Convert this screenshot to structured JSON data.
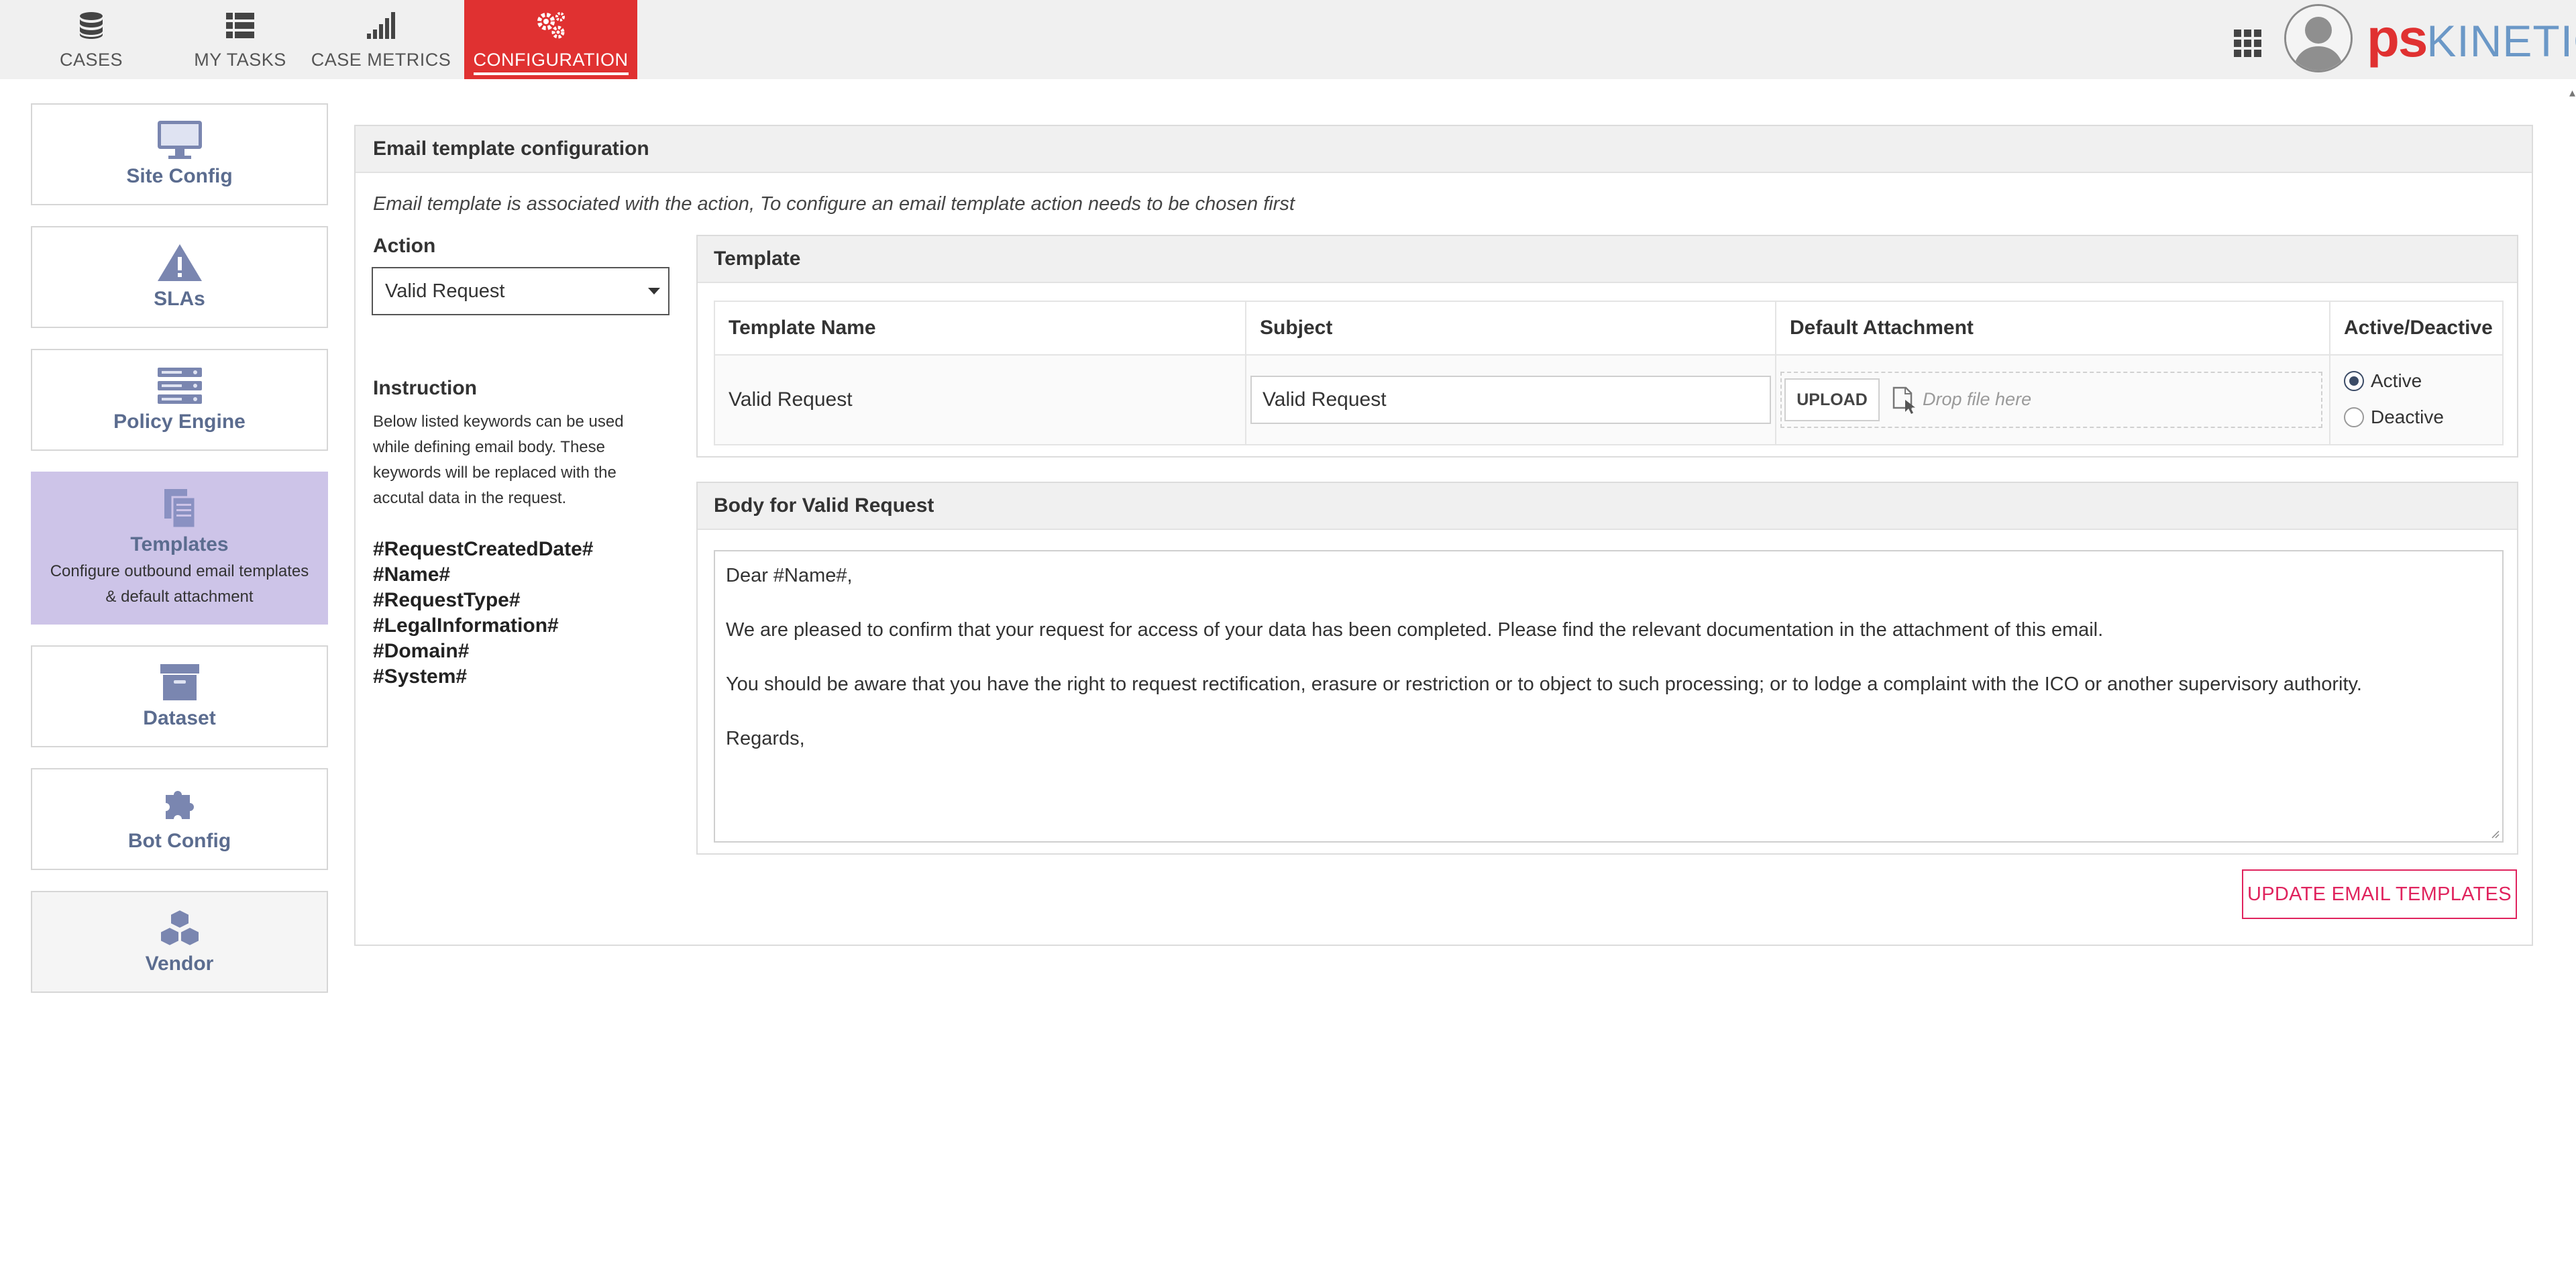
{
  "nav": {
    "items": [
      {
        "label": "CASES",
        "icon": "database-icon"
      },
      {
        "label": "MY TASKS",
        "icon": "list-icon"
      },
      {
        "label": "CASE METRICS",
        "icon": "signal-bars-icon"
      },
      {
        "label": "CONFIGURATION",
        "icon": "gears-icon",
        "active": true
      }
    ],
    "accent": "#e03131"
  },
  "brand": {
    "ps": "ps",
    "kinetic": "KINETIC"
  },
  "sidebar": {
    "items": [
      {
        "title": "Site Config",
        "icon": "monitor-icon"
      },
      {
        "title": "SLAs",
        "icon": "warning-icon"
      },
      {
        "title": "Policy Engine",
        "icon": "server-icon"
      },
      {
        "title": "Templates",
        "icon": "documents-icon",
        "description": "Configure outbound email templates & default attachment",
        "active": true
      },
      {
        "title": "Dataset",
        "icon": "archive-box-icon"
      },
      {
        "title": "Bot Config",
        "icon": "puzzle-icon"
      },
      {
        "title": "Vendor",
        "icon": "cubes-icon"
      }
    ],
    "active_color": "#cdc4e8"
  },
  "main": {
    "title": "Email template configuration",
    "note": "Email template is associated with the action, To configure an email template action needs to be chosen first",
    "action_label": "Action",
    "action_value": "Valid Request",
    "instruction_title": "Instruction",
    "instruction_text": "Below listed keywords can be used while defining email body. These keywords will be replaced with the accutal data in the request.",
    "keywords": [
      "#RequestCreatedDate#",
      "#Name#",
      "#RequestType#",
      "#LegalInformation#",
      "#Domain#",
      "#System#"
    ]
  },
  "template": {
    "title": "Template",
    "columns": [
      "Template Name",
      "Subject",
      "Default Attachment",
      "Active/Deactive"
    ],
    "row": {
      "name": "Valid Request",
      "subject": "Valid Request",
      "upload_label": "UPLOAD",
      "drop_placeholder": "Drop file here",
      "active_label": "Active",
      "deactive_label": "Deactive",
      "status": "Active"
    }
  },
  "body": {
    "title": "Body for Valid Request",
    "lines": [
      "Dear #Name#,",
      "We are pleased to confirm that your request for access of your data has been completed. Please find the relevant documentation in the attachment of this email.",
      "You should be aware that you have the right to request rectification, erasure or restriction or to object to such processing; or to lodge a complaint with the ICO or another supervisory authority.",
      "Regards,"
    ]
  },
  "update_button": {
    "label": "UPDATE EMAIL TEMPLATES",
    "color": "#e0245e"
  }
}
